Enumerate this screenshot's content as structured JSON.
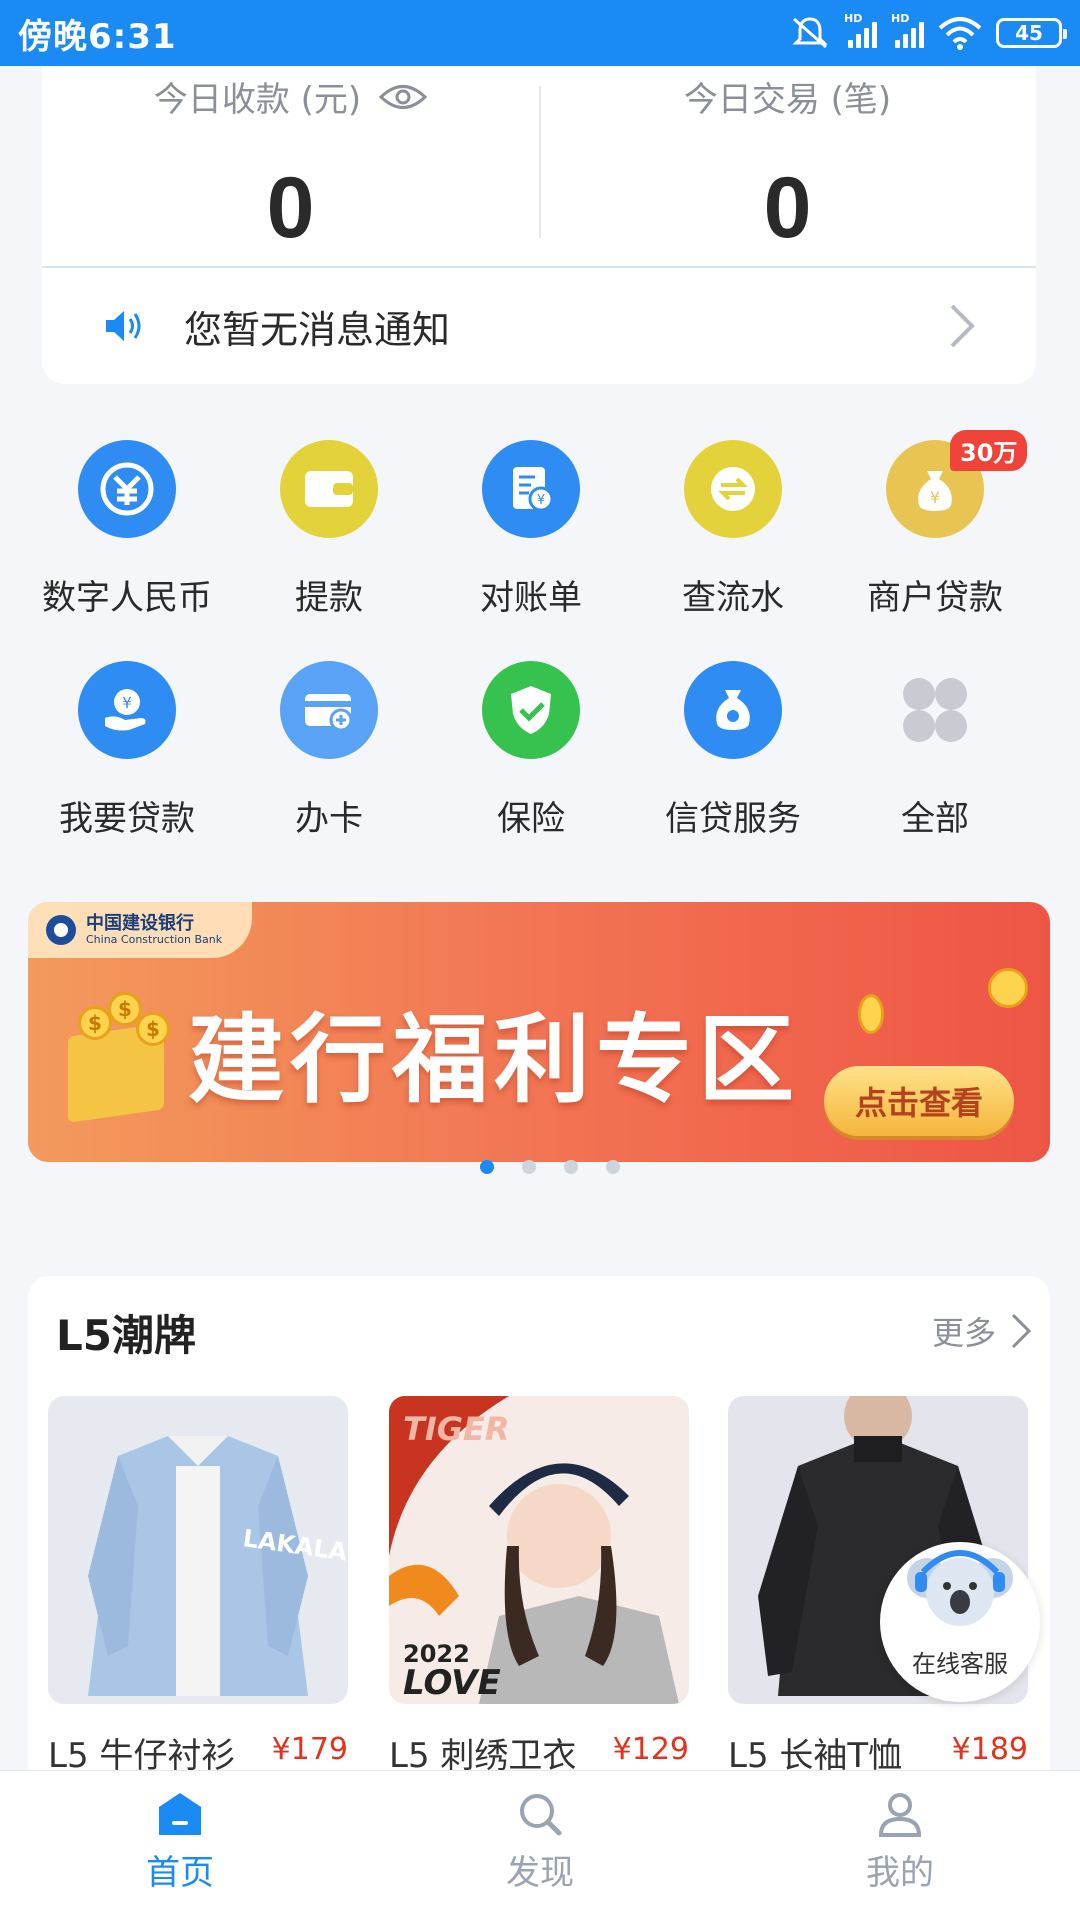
{
  "status_bar": {
    "time": "傍晚6:31",
    "battery": "45",
    "network": "HD"
  },
  "summary": {
    "receipts_label": "今日收款 (元)",
    "receipts_value": "0",
    "transactions_label": "今日交易 (笔)",
    "transactions_value": "0",
    "notice_text": "您暂无消息通知"
  },
  "services": [
    {
      "label": "数字人民币",
      "icon": "digital-rmb-icon",
      "color": "#2f8cf3"
    },
    {
      "label": "提款",
      "icon": "wallet-icon",
      "color": "#e3d23a"
    },
    {
      "label": "对账单",
      "icon": "statement-icon",
      "color": "#2f8cf3"
    },
    {
      "label": "查流水",
      "icon": "exchange-icon",
      "color": "#e3d23a"
    },
    {
      "label": "商户贷款",
      "icon": "money-bag-icon",
      "color": "#e8c552",
      "badge": "30万"
    },
    {
      "label": "我要贷款",
      "icon": "loan-hand-icon",
      "color": "#2f8cf3"
    },
    {
      "label": "办卡",
      "icon": "card-icon",
      "color": "#5aa2f5"
    },
    {
      "label": "保险",
      "icon": "shield-icon",
      "color": "#35c24e"
    },
    {
      "label": "信贷服务",
      "icon": "credit-bag-icon",
      "color": "#2f8cf3"
    },
    {
      "label": "全部",
      "icon": "all-grid-icon",
      "color": "#c8cbd1"
    }
  ],
  "banner": {
    "bank_name": "中国建设银行",
    "bank_name_en": "China Construction Bank",
    "title": "建行福利专区",
    "cta": "点击查看",
    "page_count": 4,
    "active_page": 1
  },
  "l5_section": {
    "title": "L5潮牌",
    "more": "更多",
    "products": [
      {
        "name": "L5 牛仔衬衫",
        "price": "¥179",
        "print": "LAKALA"
      },
      {
        "name": "L5 刺绣卫衣",
        "price": "¥129",
        "print_top": "TIGER",
        "print_year": "2022",
        "print_word": "LOVE"
      },
      {
        "name": "L5 长袖T恤",
        "price": "¥189"
      }
    ]
  },
  "customer_service": {
    "label": "在线客服"
  },
  "tabs": [
    {
      "label": "首页",
      "active": true
    },
    {
      "label": "发现",
      "active": false
    },
    {
      "label": "我的",
      "active": false
    }
  ]
}
